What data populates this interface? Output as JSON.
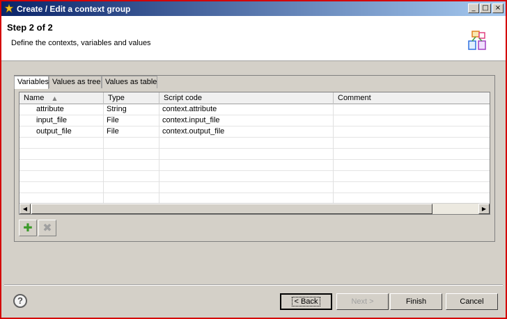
{
  "window": {
    "title": "Create / Edit a context group"
  },
  "header": {
    "step_title": "Step 2 of 2",
    "step_desc": "Define the contexts, variables and values"
  },
  "tabs": [
    {
      "label": "Variables",
      "active": true
    },
    {
      "label": "Values as tree",
      "active": false
    },
    {
      "label": "Values as table",
      "active": false
    }
  ],
  "table": {
    "columns": [
      "Name",
      "Type",
      "Script code",
      "Comment"
    ],
    "rows": [
      {
        "name": "attribute",
        "type": "String",
        "script": "context.attribute",
        "comment": ""
      },
      {
        "name": "input_file",
        "type": "File",
        "script": "context.input_file",
        "comment": ""
      },
      {
        "name": "output_file",
        "type": "File",
        "script": "context.output_file",
        "comment": ""
      }
    ]
  },
  "toolbar": {
    "add_icon": "add-icon",
    "remove_icon": "remove-icon"
  },
  "buttons": {
    "back": "< Back",
    "next": "Next >",
    "finish": "Finish",
    "cancel": "Cancel"
  },
  "colors": {
    "accent": "#0a246a",
    "border": "#d40000",
    "add_green": "#3a9a28"
  }
}
